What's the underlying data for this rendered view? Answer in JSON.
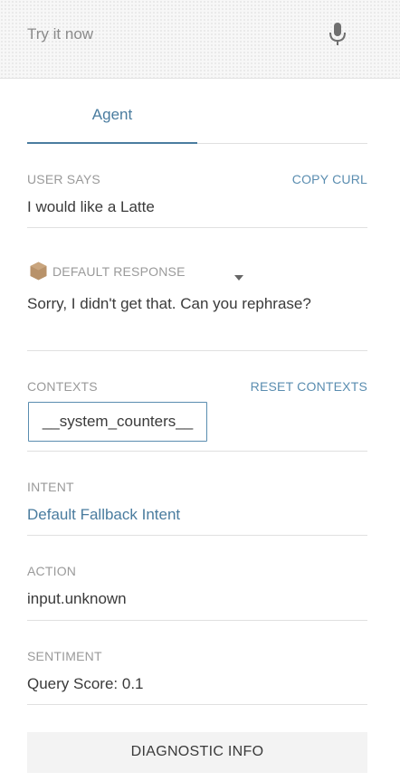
{
  "try_bar": {
    "placeholder": "Try it now",
    "mic_icon": "microphone-icon"
  },
  "tabs": [
    {
      "label": "Agent",
      "active": true
    }
  ],
  "user_says": {
    "label": "USER SAYS",
    "copy_curl": "COPY CURL",
    "text": "I would like a Latte"
  },
  "default_response": {
    "label": "DEFAULT RESPONSE",
    "icon": "hexagon-icon",
    "text": "Sorry, I didn't get that. Can you rephrase?"
  },
  "contexts": {
    "label": "CONTEXTS",
    "reset": "RESET CONTEXTS",
    "items": [
      "__system_counters__"
    ]
  },
  "intent": {
    "label": "INTENT",
    "value": "Default Fallback Intent"
  },
  "action": {
    "label": "ACTION",
    "value": "input.unknown"
  },
  "sentiment": {
    "label": "SENTIMENT",
    "value": "Query Score: 0.1"
  },
  "diagnostic": {
    "label": "DIAGNOSTIC INFO"
  },
  "colors": {
    "accent": "#4a7c9f",
    "link": "#5a8db0",
    "label": "#9a9a9a",
    "icon_brown": "#b8926a"
  }
}
